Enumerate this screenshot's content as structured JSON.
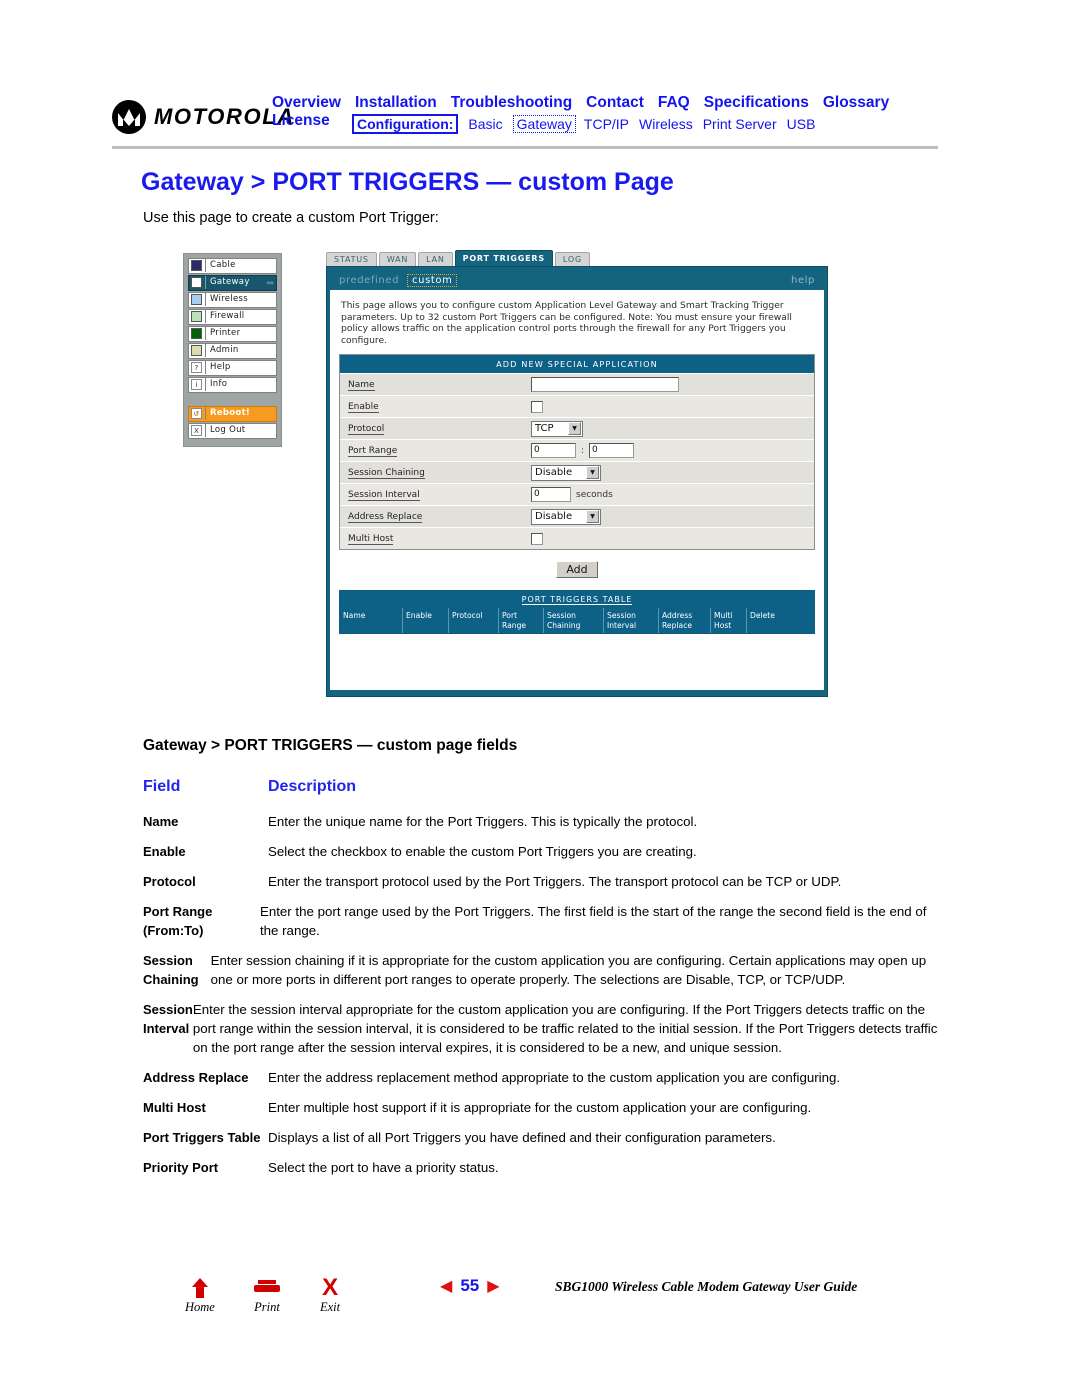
{
  "brand": {
    "name": "MOTOROLA"
  },
  "nav": {
    "primary": [
      "Overview",
      "Installation",
      "Troubleshooting",
      "Contact",
      "FAQ",
      "Specifications",
      "Glossary",
      "License"
    ],
    "config_label": "Configuration:",
    "secondary": [
      "Basic",
      "Gateway",
      "TCP/IP",
      "Wireless",
      "Print Server",
      "USB"
    ],
    "active_secondary": "Gateway",
    "link_color": "#1414ef"
  },
  "page": {
    "title": "Gateway > PORT TRIGGERS — custom Page",
    "intro": "Use this page to create a custom Port Trigger:"
  },
  "screenshot": {
    "sidebar": [
      {
        "label": "Cable",
        "swatch": "#2b2b6b",
        "selected": false
      },
      {
        "label": "Gateway",
        "swatch": "#ffffff",
        "selected": true,
        "arrow": "»»"
      },
      {
        "label": "Wireless",
        "swatch": "#a8cdf0",
        "selected": false
      },
      {
        "label": "Firewall",
        "swatch": "#b9e2b9",
        "selected": false
      },
      {
        "label": "Printer",
        "swatch": "#056105",
        "selected": false
      },
      {
        "label": "Admin",
        "swatch": "#dcdcae",
        "selected": false
      }
    ],
    "sidebar_glyph_items": [
      {
        "label": "Help",
        "glyph": "?"
      },
      {
        "label": "Info",
        "glyph": "i"
      }
    ],
    "sidebar_actions": [
      {
        "label": "Reboot!",
        "glyph": "↺",
        "style": "reboot"
      },
      {
        "label": "Log Out",
        "glyph": "X",
        "style": "normal"
      }
    ],
    "tabs": [
      {
        "label": "STATUS",
        "active": false
      },
      {
        "label": "WAN",
        "active": false
      },
      {
        "label": "LAN",
        "active": false
      },
      {
        "label": "PORT TRIGGERS",
        "active": true
      },
      {
        "label": "LOG",
        "active": false
      }
    ],
    "subbar": {
      "predefined": "predefined",
      "custom": "custom",
      "help": "help"
    },
    "blurb": "This page allows you to configure custom Application Level Gateway and Smart Tracking Trigger parameters. Up to 32 custom Port Triggers can be configured. Note: You must ensure your firewall policy allows traffic on the application control ports through the firewall for any Port Triggers you configure.",
    "form": {
      "header": "ADD NEW SPECIAL APPLICATION",
      "rows": [
        {
          "label": "Name",
          "type": "text",
          "value": ""
        },
        {
          "label": "Enable",
          "type": "checkbox",
          "checked": false
        },
        {
          "label": "Protocol",
          "type": "select",
          "value": "TCP"
        },
        {
          "label": "Port Range",
          "type": "range",
          "from": "0",
          "to": "0",
          "separator": ":"
        },
        {
          "label": "Session Chaining",
          "type": "select",
          "value": "Disable"
        },
        {
          "label": "Session Interval",
          "type": "text",
          "value": "0",
          "unit": "seconds"
        },
        {
          "label": "Address Replace",
          "type": "select",
          "value": "Disable"
        },
        {
          "label": "Multi Host",
          "type": "checkbox",
          "checked": false
        }
      ],
      "add_button": "Add"
    },
    "triggers_table": {
      "title": "PORT TRIGGERS TABLE",
      "columns": [
        "Name",
        "Enable",
        "Protocol",
        "Port Range",
        "Session Chaining",
        "Session Interval",
        "Address Replace",
        "Multi Host",
        "Delete"
      ],
      "rows": []
    },
    "colors": {
      "panel_blue": "#14637f",
      "header_blue": "#0d6187",
      "reboot_orange": "#f79a1e"
    }
  },
  "fields_section": {
    "heading": "Gateway > PORT TRIGGERS — custom page fields",
    "col_headers": {
      "field": "Field",
      "description": "Description"
    },
    "rows": [
      {
        "field": "Name",
        "description": "Enter the unique name for the Port Triggers. This is typically the protocol."
      },
      {
        "field": "Enable",
        "description": "Select the checkbox to enable the custom Port Triggers you are creating."
      },
      {
        "field": "Protocol",
        "description": "Enter the transport protocol used by the Port Triggers. The transport protocol can be TCP or UDP."
      },
      {
        "field": "Port Range (From:To)",
        "description": "Enter the port range used by the Port Triggers. The first field is the start of the range the second field is the end of the range."
      },
      {
        "field": "Session Chaining",
        "description": "Enter session chaining if it is appropriate for the custom application you are configuring. Certain applications may open up one or more ports in different port ranges to operate properly. The selections are Disable, TCP, or TCP/UDP."
      },
      {
        "field": "Session Interval",
        "description": "Enter the session interval appropriate for the custom application you are configuring. If the Port Triggers detects traffic on the port range within the session interval, it is considered to be traffic related to the initial session. If the Port Triggers detects traffic on the port range after the session interval expires, it is considered to be a new, and unique session."
      },
      {
        "field": "Address Replace",
        "description": "Enter the address replacement method appropriate to the custom application you are configuring."
      },
      {
        "field": "Multi Host",
        "description": "Enter multiple host support if it is appropriate for the custom application your are configuring."
      },
      {
        "field": "Port Triggers Table",
        "description": "Displays a list of all Port Triggers you have defined and their configuration parameters."
      },
      {
        "field": "Priority Port",
        "description": "Select the port to have a priority status."
      }
    ]
  },
  "footer": {
    "buttons": [
      {
        "label": "Home",
        "icon": "home-arrow-icon"
      },
      {
        "label": "Print",
        "icon": "printer-icon"
      },
      {
        "label": "Exit",
        "icon": "x-icon"
      }
    ],
    "prev": "◀",
    "next": "▶",
    "page_number": "55",
    "guide_title": "SBG1000 Wireless Cable Modem Gateway User Guide"
  }
}
